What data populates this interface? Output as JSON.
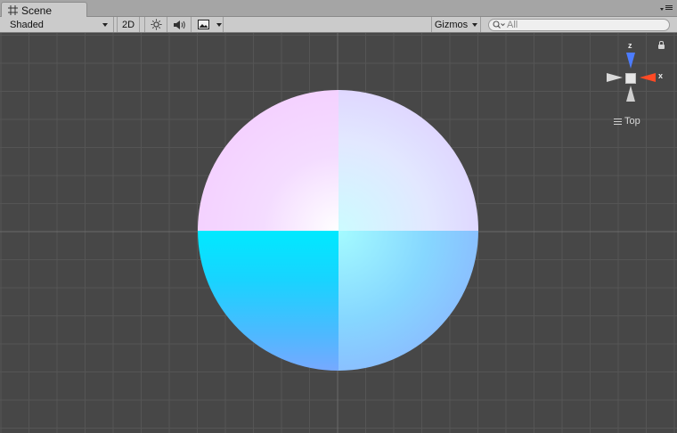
{
  "tab": {
    "label": "Scene"
  },
  "toolbar": {
    "shading_mode": "Shaded",
    "mode_2d": "2D",
    "gizmos_label": "Gizmos",
    "search_placeholder": "All"
  },
  "gizmo": {
    "axis_z": "z",
    "axis_x": "x",
    "view_label": "Top",
    "colors": {
      "z": "#4c7cff",
      "x": "#ff4a25",
      "neutral": "#d9d9d9"
    }
  },
  "viewport": {
    "background": "#474747",
    "grid_color": "#555555",
    "axis_line_color": "#6a6a6a"
  },
  "scene_object": {
    "type": "disc",
    "colors": {
      "top": "#f3c8ff",
      "center": "#ffffff",
      "cyan": "#00e9ff",
      "bottom": "#8ea7ff"
    }
  }
}
